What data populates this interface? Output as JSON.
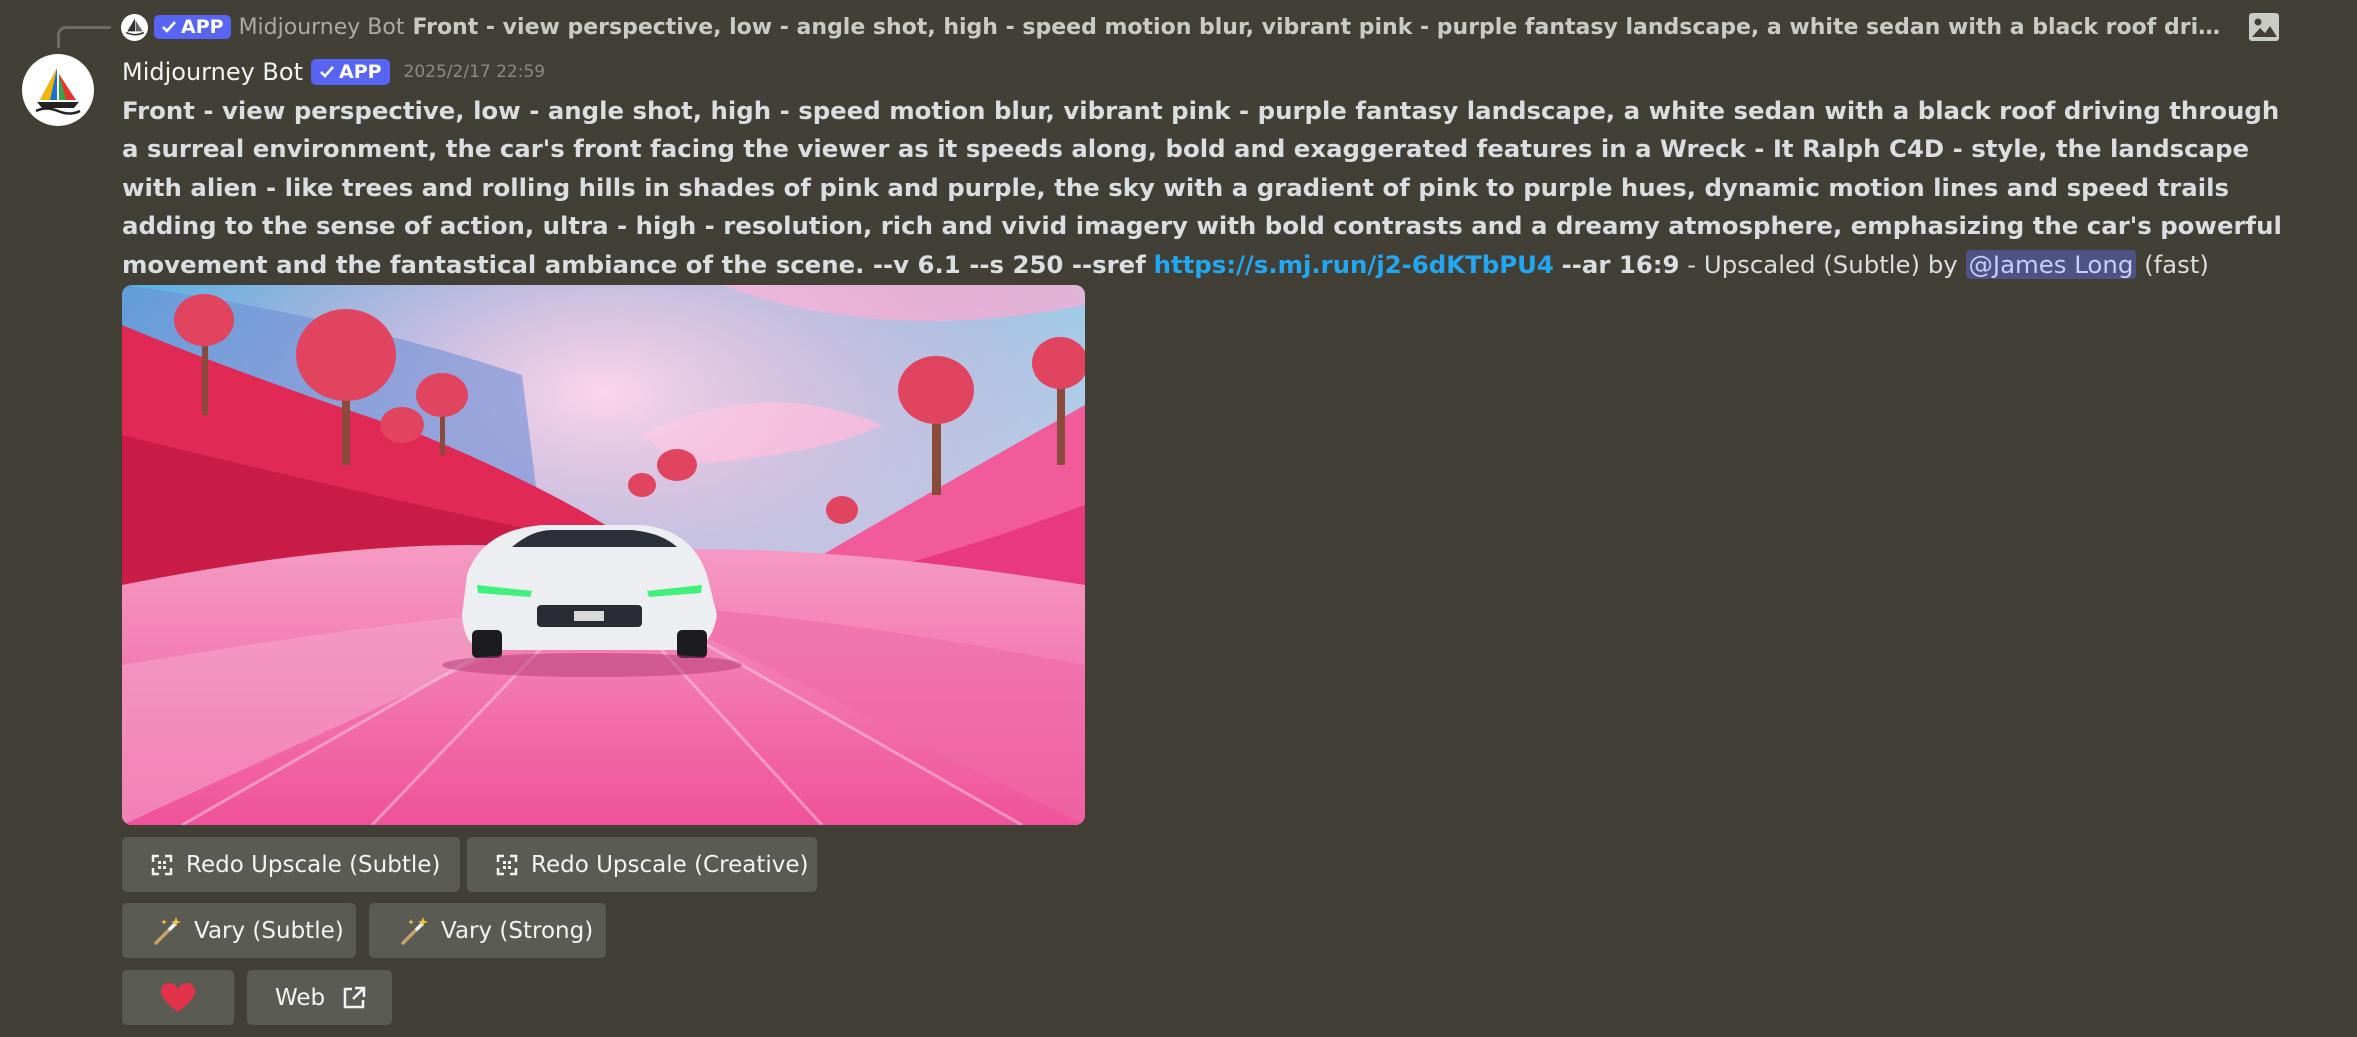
{
  "reply": {
    "badge": "APP",
    "name": "Midjourney Bot",
    "text": "Front - view perspective, low - angle shot, high - speed motion blur, vibrant pink - purple fantasy landscape, a white sedan with a black roof driving through a surreal e..."
  },
  "message": {
    "author": "Midjourney Bot",
    "badge": "APP",
    "timestamp": "2025/2/17 22:59",
    "prompt": "Front - view perspective, low - angle shot, high - speed motion blur, vibrant pink - purple fantasy landscape, a white sedan with a black roof driving through a surreal environment, the car's front facing the viewer as it speeds along, bold and exaggerated features in a Wreck - It Ralph C4D - style, the landscape with alien - like trees and rolling hills in shades of pink and purple, the sky with a gradient of pink to purple hues, dynamic motion lines and speed trails adding to the sense of action, ultra - high - resolution, rich and vivid imagery with bold contrasts and a dreamy atmosphere, emphasizing the car's powerful movement and the fantastical ambiance of the scene. --v 6.1 --s 250 --sref",
    "link": "https://s.mj.run/j2-6dKTbPU4",
    "params": "--ar 16:9",
    "suffix_pre": "- Upscaled (Subtle) by",
    "mention": "@James Long",
    "suffix_post": "(fast)"
  },
  "buttons": {
    "redo_subtle": "Redo Upscale (Subtle)",
    "redo_creative": "Redo Upscale (Creative)",
    "vary_subtle": "Vary (Subtle)",
    "vary_strong": "Vary (Strong)",
    "web": "Web"
  },
  "icons": {
    "reply_image": "image-icon",
    "upscale": "expand-icon",
    "vary": "magic-wand-icon",
    "favorite": "heart-icon",
    "external": "external-link-icon",
    "avatar": "sailboat-logo-icon"
  },
  "colors": {
    "background": "#424036",
    "badge": "#5865f2",
    "link": "#22a7f2",
    "mention_bg": "#4e5385",
    "button_bg": "#5a5b52",
    "heart": "#e2334a"
  }
}
